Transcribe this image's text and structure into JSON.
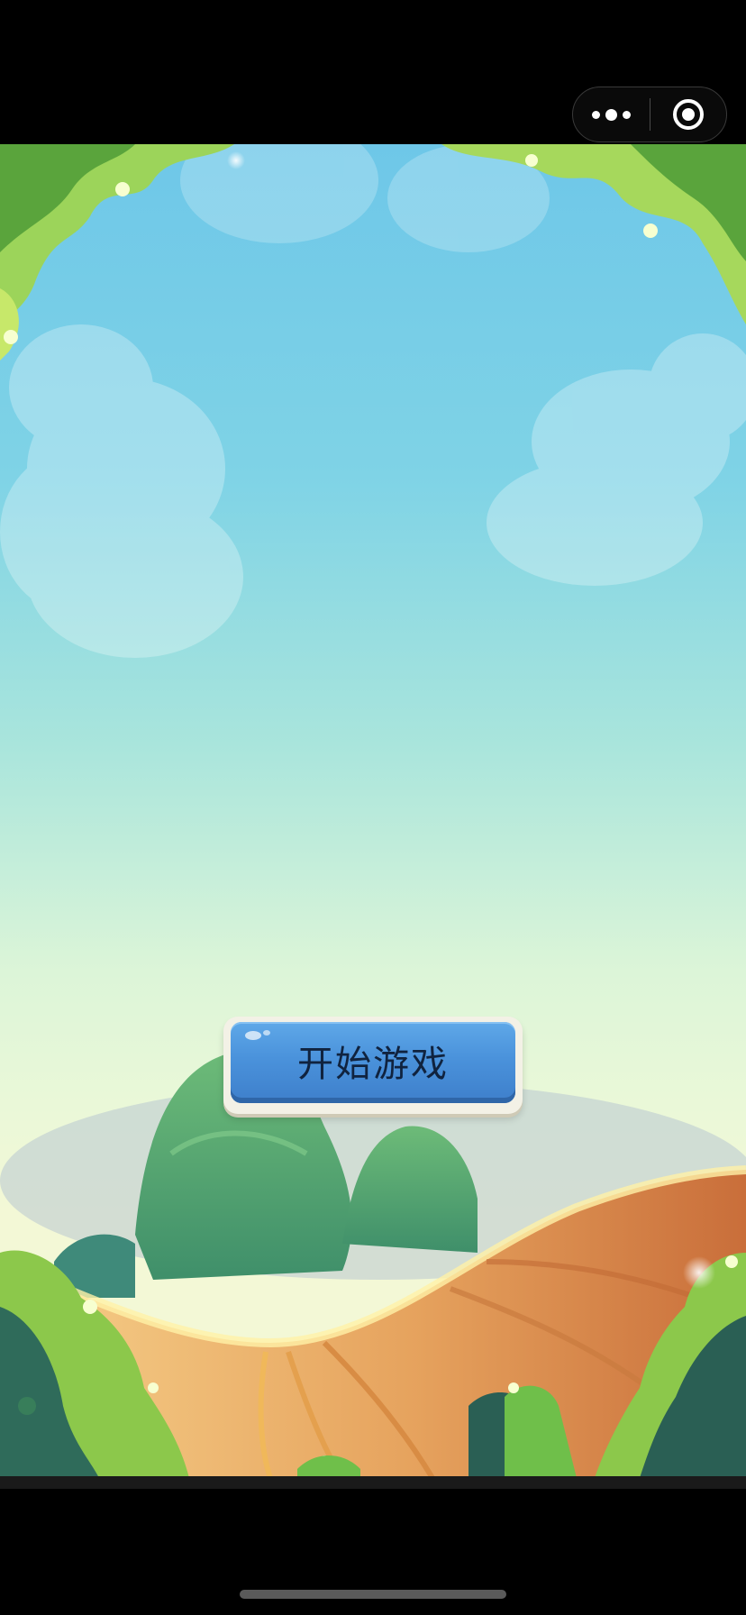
{
  "capsule": {
    "more_icon": "more-dots-icon",
    "close_icon": "target-circle-icon"
  },
  "game": {
    "start_button_label": "开始游戏"
  },
  "colors": {
    "sky_top": "#6ec7e8",
    "sky_bottom": "#f3f8d6",
    "button_blue": "#4a92db",
    "button_text": "#10233f",
    "hill_orange": "#d9894a",
    "foliage_green": "#8cc84b"
  }
}
